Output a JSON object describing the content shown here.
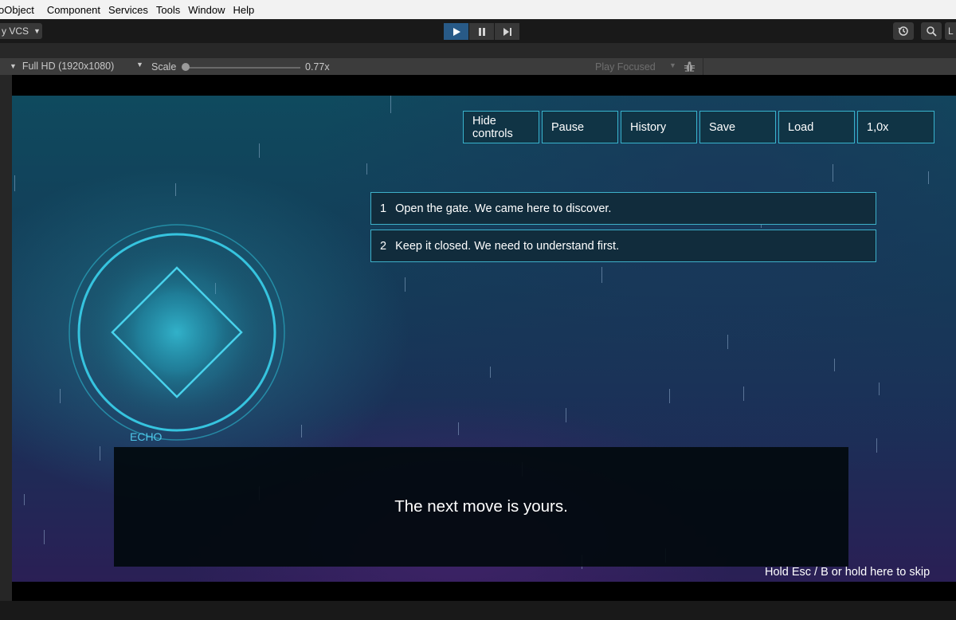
{
  "menu": [
    "oObject",
    "Component",
    "Services",
    "Tools",
    "Window",
    "Help"
  ],
  "toolbar": {
    "vcs_label": "y VCS",
    "play_icon": "play-icon",
    "pause_icon": "pause-icon",
    "step_icon": "step-icon",
    "right_partial_label": "L"
  },
  "gamebar": {
    "resolution": "Full HD (1920x1080)",
    "scale_label": "Scale",
    "scale_value": "0.77x",
    "scale_fraction": 0.0,
    "play_mode": "Play Focused"
  },
  "game": {
    "buttons": [
      {
        "label": "Hide controls"
      },
      {
        "label": "Pause"
      },
      {
        "label": "History"
      },
      {
        "label": "Save"
      },
      {
        "label": "Load"
      },
      {
        "label": "1,0x"
      }
    ],
    "choices": [
      {
        "num": "1",
        "text": "Open the gate. We came here to discover."
      },
      {
        "num": "2",
        "text": "Keep it closed. We need to understand first."
      }
    ],
    "speaker": "ECHO",
    "dialogue": "The next move is yours.",
    "skip_hint": "Hold Esc / B or hold here to skip",
    "colors": {
      "accent": "#38b3cc",
      "speaker": "#4fc6e8"
    }
  }
}
